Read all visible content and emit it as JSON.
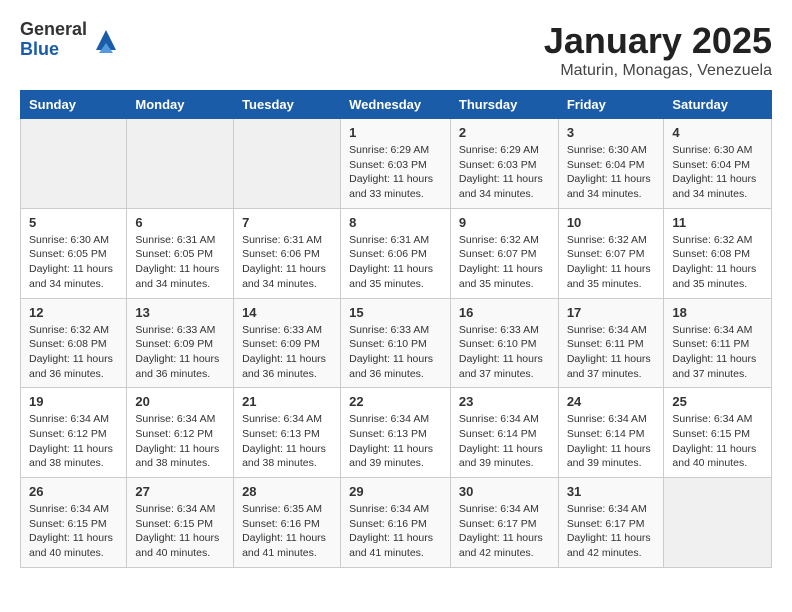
{
  "header": {
    "logo_general": "General",
    "logo_blue": "Blue",
    "month_title": "January 2025",
    "subtitle": "Maturin, Monagas, Venezuela"
  },
  "weekdays": [
    "Sunday",
    "Monday",
    "Tuesday",
    "Wednesday",
    "Thursday",
    "Friday",
    "Saturday"
  ],
  "weeks": [
    [
      {
        "day": "",
        "info": ""
      },
      {
        "day": "",
        "info": ""
      },
      {
        "day": "",
        "info": ""
      },
      {
        "day": "1",
        "info": "Sunrise: 6:29 AM\nSunset: 6:03 PM\nDaylight: 11 hours\nand 33 minutes."
      },
      {
        "day": "2",
        "info": "Sunrise: 6:29 AM\nSunset: 6:03 PM\nDaylight: 11 hours\nand 34 minutes."
      },
      {
        "day": "3",
        "info": "Sunrise: 6:30 AM\nSunset: 6:04 PM\nDaylight: 11 hours\nand 34 minutes."
      },
      {
        "day": "4",
        "info": "Sunrise: 6:30 AM\nSunset: 6:04 PM\nDaylight: 11 hours\nand 34 minutes."
      }
    ],
    [
      {
        "day": "5",
        "info": "Sunrise: 6:30 AM\nSunset: 6:05 PM\nDaylight: 11 hours\nand 34 minutes."
      },
      {
        "day": "6",
        "info": "Sunrise: 6:31 AM\nSunset: 6:05 PM\nDaylight: 11 hours\nand 34 minutes."
      },
      {
        "day": "7",
        "info": "Sunrise: 6:31 AM\nSunset: 6:06 PM\nDaylight: 11 hours\nand 34 minutes."
      },
      {
        "day": "8",
        "info": "Sunrise: 6:31 AM\nSunset: 6:06 PM\nDaylight: 11 hours\nand 35 minutes."
      },
      {
        "day": "9",
        "info": "Sunrise: 6:32 AM\nSunset: 6:07 PM\nDaylight: 11 hours\nand 35 minutes."
      },
      {
        "day": "10",
        "info": "Sunrise: 6:32 AM\nSunset: 6:07 PM\nDaylight: 11 hours\nand 35 minutes."
      },
      {
        "day": "11",
        "info": "Sunrise: 6:32 AM\nSunset: 6:08 PM\nDaylight: 11 hours\nand 35 minutes."
      }
    ],
    [
      {
        "day": "12",
        "info": "Sunrise: 6:32 AM\nSunset: 6:08 PM\nDaylight: 11 hours\nand 36 minutes."
      },
      {
        "day": "13",
        "info": "Sunrise: 6:33 AM\nSunset: 6:09 PM\nDaylight: 11 hours\nand 36 minutes."
      },
      {
        "day": "14",
        "info": "Sunrise: 6:33 AM\nSunset: 6:09 PM\nDaylight: 11 hours\nand 36 minutes."
      },
      {
        "day": "15",
        "info": "Sunrise: 6:33 AM\nSunset: 6:10 PM\nDaylight: 11 hours\nand 36 minutes."
      },
      {
        "day": "16",
        "info": "Sunrise: 6:33 AM\nSunset: 6:10 PM\nDaylight: 11 hours\nand 37 minutes."
      },
      {
        "day": "17",
        "info": "Sunrise: 6:34 AM\nSunset: 6:11 PM\nDaylight: 11 hours\nand 37 minutes."
      },
      {
        "day": "18",
        "info": "Sunrise: 6:34 AM\nSunset: 6:11 PM\nDaylight: 11 hours\nand 37 minutes."
      }
    ],
    [
      {
        "day": "19",
        "info": "Sunrise: 6:34 AM\nSunset: 6:12 PM\nDaylight: 11 hours\nand 38 minutes."
      },
      {
        "day": "20",
        "info": "Sunrise: 6:34 AM\nSunset: 6:12 PM\nDaylight: 11 hours\nand 38 minutes."
      },
      {
        "day": "21",
        "info": "Sunrise: 6:34 AM\nSunset: 6:13 PM\nDaylight: 11 hours\nand 38 minutes."
      },
      {
        "day": "22",
        "info": "Sunrise: 6:34 AM\nSunset: 6:13 PM\nDaylight: 11 hours\nand 39 minutes."
      },
      {
        "day": "23",
        "info": "Sunrise: 6:34 AM\nSunset: 6:14 PM\nDaylight: 11 hours\nand 39 minutes."
      },
      {
        "day": "24",
        "info": "Sunrise: 6:34 AM\nSunset: 6:14 PM\nDaylight: 11 hours\nand 39 minutes."
      },
      {
        "day": "25",
        "info": "Sunrise: 6:34 AM\nSunset: 6:15 PM\nDaylight: 11 hours\nand 40 minutes."
      }
    ],
    [
      {
        "day": "26",
        "info": "Sunrise: 6:34 AM\nSunset: 6:15 PM\nDaylight: 11 hours\nand 40 minutes."
      },
      {
        "day": "27",
        "info": "Sunrise: 6:34 AM\nSunset: 6:15 PM\nDaylight: 11 hours\nand 40 minutes."
      },
      {
        "day": "28",
        "info": "Sunrise: 6:35 AM\nSunset: 6:16 PM\nDaylight: 11 hours\nand 41 minutes."
      },
      {
        "day": "29",
        "info": "Sunrise: 6:34 AM\nSunset: 6:16 PM\nDaylight: 11 hours\nand 41 minutes."
      },
      {
        "day": "30",
        "info": "Sunrise: 6:34 AM\nSunset: 6:17 PM\nDaylight: 11 hours\nand 42 minutes."
      },
      {
        "day": "31",
        "info": "Sunrise: 6:34 AM\nSunset: 6:17 PM\nDaylight: 11 hours\nand 42 minutes."
      },
      {
        "day": "",
        "info": ""
      }
    ]
  ]
}
